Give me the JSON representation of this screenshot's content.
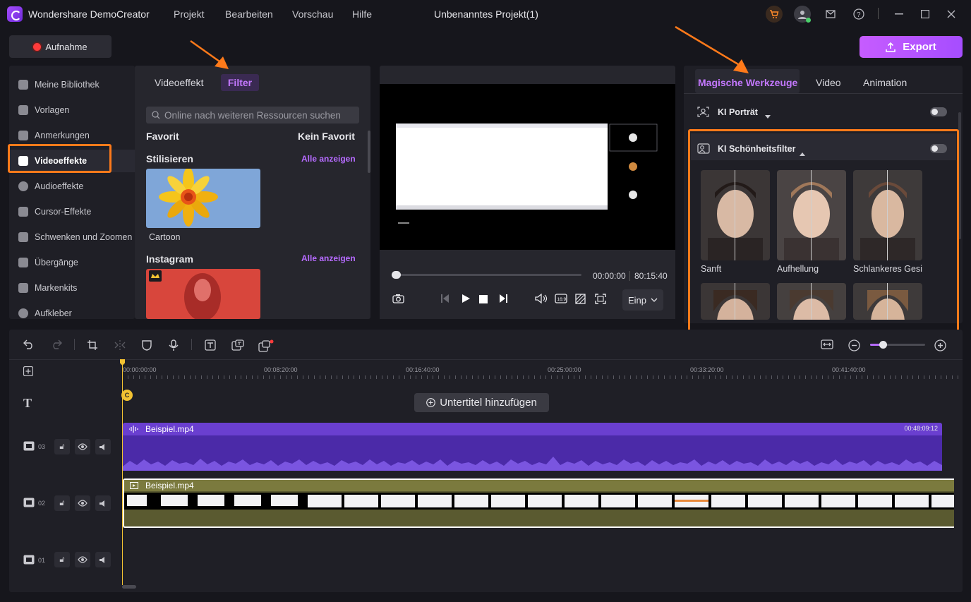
{
  "app": {
    "title": "Wondershare DemoCreator",
    "menu": [
      "Projekt",
      "Bearbeiten",
      "Vorschau",
      "Hilfe"
    ],
    "project_title": "Unbenanntes Projekt(1)"
  },
  "toolbar": {
    "record_label": "Aufnahme",
    "export_label": "Export"
  },
  "sidebar": {
    "items": [
      {
        "label": "Meine Bibliothek",
        "icon": "layers-icon"
      },
      {
        "label": "Vorlagen",
        "icon": "template-icon"
      },
      {
        "label": "Anmerkungen",
        "icon": "annotation-icon"
      },
      {
        "label": "Videoeffekte",
        "icon": "video-effects-icon",
        "active": true
      },
      {
        "label": "Audioeffekte",
        "icon": "music-note-icon"
      },
      {
        "label": "Cursor-Effekte",
        "icon": "cursor-icon"
      },
      {
        "label": "Schwenken und Zoomen",
        "icon": "pan-zoom-icon"
      },
      {
        "label": "Übergänge",
        "icon": "transition-icon"
      },
      {
        "label": "Markenkits",
        "icon": "brand-kit-icon"
      },
      {
        "label": "Aufkleber",
        "icon": "sticker-icon"
      }
    ]
  },
  "effects": {
    "tabs": [
      "Videoeffekt",
      "Filter"
    ],
    "active_tab": "Filter",
    "search_placeholder": "Online nach weiteren Ressourcen suchen",
    "favorite_label": "Favorit",
    "no_favorite_label": "Kein Favorit",
    "sections": [
      {
        "title": "Stilisieren",
        "link": "Alle anzeigen",
        "item": "Cartoon"
      },
      {
        "title": "Instagram",
        "link": "Alle anzeigen"
      }
    ]
  },
  "preview": {
    "current_time": "00:00:00",
    "total_time": "80:15:40",
    "progress": 0.0,
    "fit_option": "Einp"
  },
  "right_panel": {
    "tabs": [
      "Magische Werkzeuge",
      "Video",
      "Animation"
    ],
    "active_tab": "Magische Werkzeuge",
    "portrait_label": "KI Porträt",
    "beauty_label": "KI Schönheitsfilter",
    "filters": [
      "Sanft",
      "Aufhellung",
      "Schlankeres Gesich"
    ]
  },
  "timeline": {
    "ruler": [
      "00:00:00:00",
      "00:08:20:00",
      "00:16:40:00",
      "00:25:00:00",
      "00:33:20:00",
      "00:41:40:00"
    ],
    "subtitle_button": "Untertitel hinzufügen",
    "tracks": [
      {
        "num": "03",
        "clip": "Beispiel.mp4",
        "duration": "00:48:09:12"
      },
      {
        "num": "02",
        "clip": "Beispiel.mp4"
      },
      {
        "num": "01"
      }
    ]
  },
  "colors": {
    "accent": "#a64dff",
    "highlight": "#ff7a1a",
    "audio_clip": "#6a3fd0",
    "video_clip": "#7b7a3e"
  }
}
